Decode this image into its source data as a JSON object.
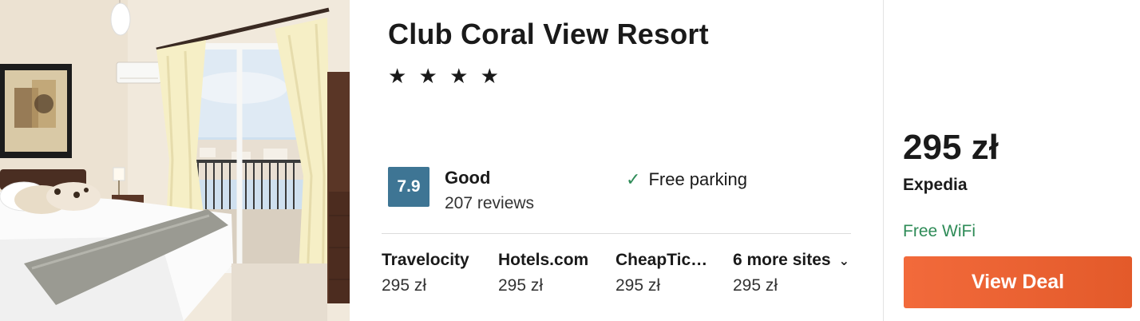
{
  "hotel": {
    "name": "Club Coral View Resort",
    "stars": "★ ★ ★ ★",
    "star_count": 4,
    "rating_score": "7.9",
    "rating_word": "Good",
    "rating_count": "207 reviews",
    "amenity": "Free parking",
    "amenity_icon": "check-icon"
  },
  "providers": [
    {
      "name": "Travelocity",
      "price": "295 zł"
    },
    {
      "name": "Hotels.com",
      "price": "295 zł"
    },
    {
      "name": "CheapTic…",
      "price": "295 zł"
    },
    {
      "name": "6 more sites",
      "price": "295 zł"
    }
  ],
  "deal": {
    "price": "295 zł",
    "provider": "Expedia",
    "perk": "Free WiFi",
    "button_label": "View Deal"
  },
  "colors": {
    "rating_badge": "#3e7594",
    "cta": "#f26a3b",
    "perk_green": "#2e8b57"
  }
}
